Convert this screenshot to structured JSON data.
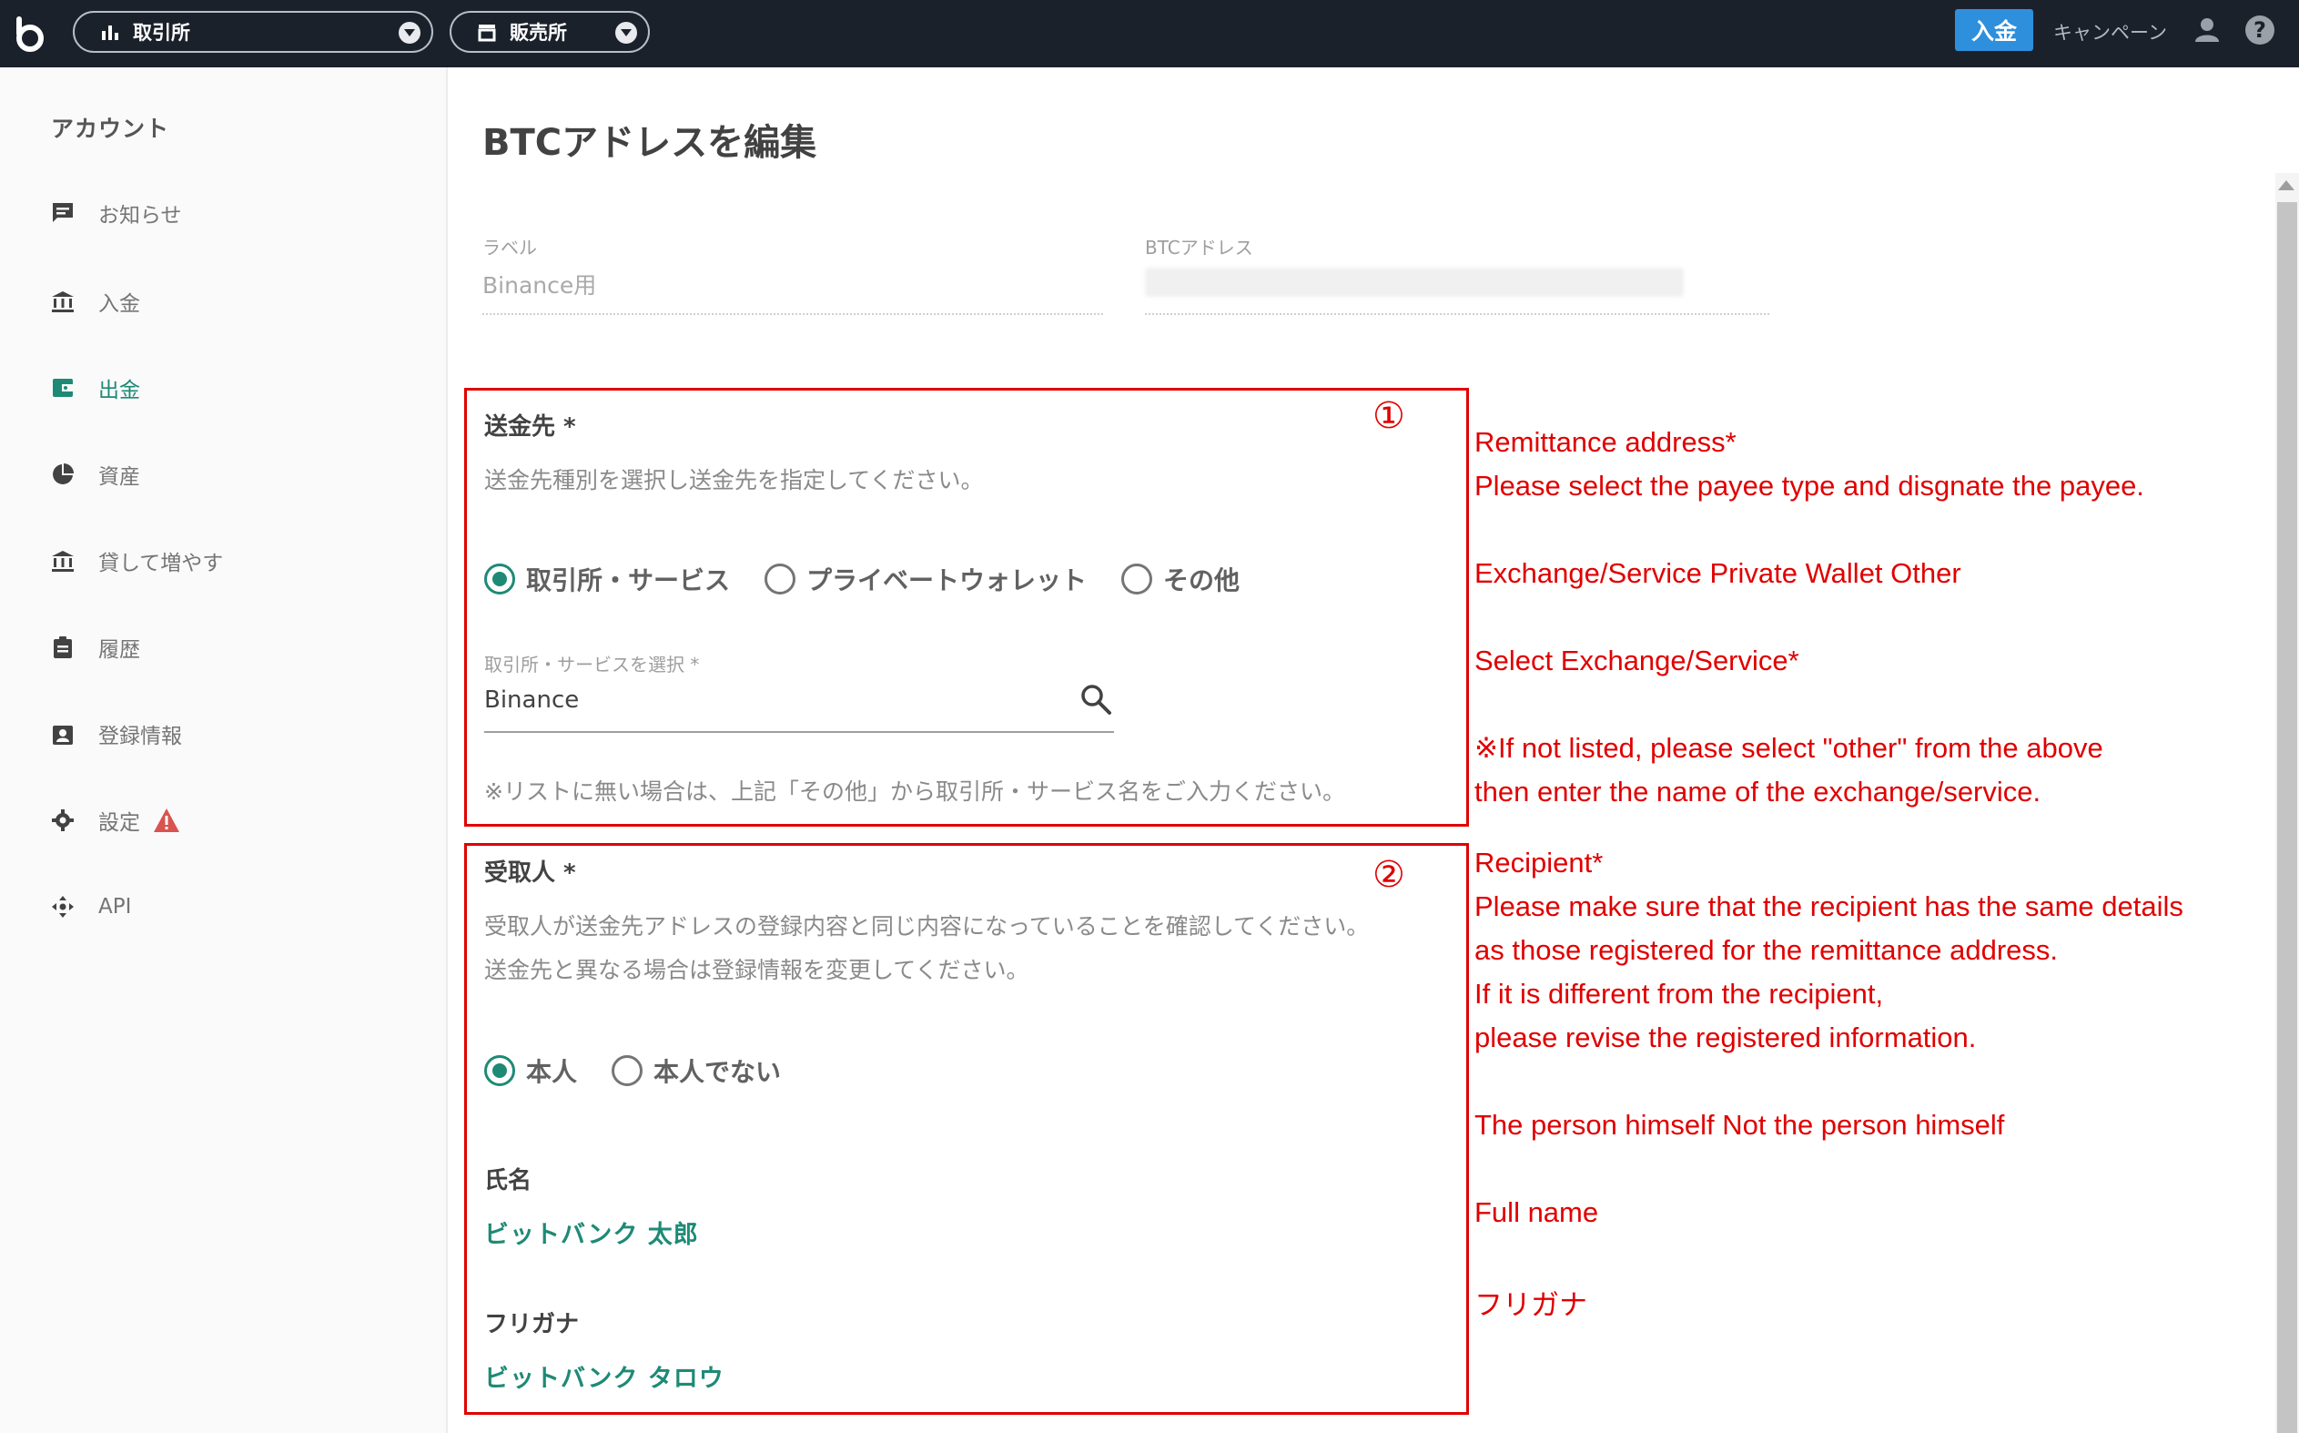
{
  "topbar": {
    "exchange_label": "取引所",
    "shop_label": "販売所",
    "deposit_button": "入金",
    "campaign": "キャンペーン",
    "bg_color": "#1b212b"
  },
  "sidebar": {
    "heading": "アカウント",
    "items": [
      {
        "label": "お知らせ",
        "icon": "message-icon"
      },
      {
        "label": "入金",
        "icon": "bank-icon"
      },
      {
        "label": "出金",
        "icon": "wallet-icon",
        "active": true
      },
      {
        "label": "資産",
        "icon": "pie-chart-icon"
      },
      {
        "label": "貸して増やす",
        "icon": "bank-icon"
      },
      {
        "label": "履歴",
        "icon": "clipboard-icon"
      },
      {
        "label": "登録情報",
        "icon": "id-card-icon"
      },
      {
        "label": "設定",
        "icon": "gear-icon",
        "badge": "warning-icon"
      },
      {
        "label": "API",
        "icon": "api-icon"
      }
    ]
  },
  "main": {
    "title": "BTCアドレスを編集",
    "label_field": {
      "label": "ラベル",
      "value": "Binance用"
    },
    "address_field": {
      "label": "BTCアドレス"
    },
    "section1": {
      "number": "①",
      "title": "送金先 *",
      "description": "送金先種別を選択し送金先を指定してください。",
      "options": [
        "取引所・サービス",
        "プライベートウォレット",
        "その他"
      ],
      "selected": 0,
      "select_label": "取引所・サービスを選択 *",
      "select_value": "Binance",
      "note": "※リストに無い場合は、上記「その他」から取引所・サービス名をご入力ください。"
    },
    "section2": {
      "number": "②",
      "title": "受取人 *",
      "description1": "受取人が送金先アドレスの登録内容と同じ内容になっていることを確認してください。",
      "description2": "送金先と異なる場合は登録情報を変更してください。",
      "options": [
        "本人",
        "本人でない"
      ],
      "selected": 0,
      "name_label": "氏名",
      "name_value": "ビットバンク 太郎",
      "kana_label": "フリガナ",
      "kana_value": "ビットバンク タロウ"
    }
  },
  "annotations": {
    "a1": "Remittance address*",
    "a2": "Please select the payee type and disgnate the payee.",
    "a3": "Exchange/Service  Private Wallet  Other",
    "a4": "Select Exchange/Service*",
    "a5": "※If not listed, please select \"other\" from the above",
    "a6": "then enter the name of the exchange/service.",
    "a7": "Recipient*",
    "a8": "Please make sure that the recipient has the same details",
    "a9": "as those registered for the remittance address.",
    "a10": "If it is different from the recipient,",
    "a11": "please revise the registered information.",
    "a12": "The person himself  Not the person himself",
    "a13": "Full name",
    "a14": "フリガナ",
    "color": "#e00000"
  }
}
